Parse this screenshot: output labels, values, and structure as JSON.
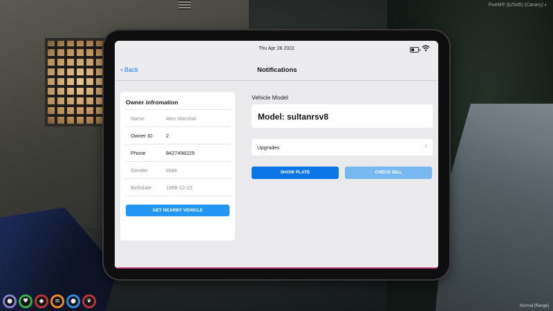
{
  "overlay": {
    "fivem_label": "FiveM® (b2545) (Canary) ◐",
    "voice_range": "Normal [Range]"
  },
  "hud": {
    "icons": [
      {
        "name": "microphone-icon",
        "glyph": "🎙",
        "color": "#8a7fd8"
      },
      {
        "name": "heart-icon",
        "glyph": "♥",
        "color": "#34b24a"
      },
      {
        "name": "shield-icon",
        "glyph": "⛉",
        "color": "#c0323a"
      },
      {
        "name": "burger-icon",
        "glyph": "≡",
        "color": "#f08a24"
      },
      {
        "name": "water-drop-icon",
        "glyph": "💧",
        "color": "#2a8ae0"
      },
      {
        "name": "brain-icon",
        "glyph": "❦",
        "color": "#c0323a"
      }
    ]
  },
  "tablet": {
    "status": {
      "date": "Thu Apr 28 2022"
    },
    "nav": {
      "back_label": "Back",
      "title": "Notifications"
    },
    "owner": {
      "title": "Owner infromation",
      "rows": [
        {
          "label": "Name",
          "value": "Alex Marshal"
        },
        {
          "label": "Owner ID",
          "value": "2"
        },
        {
          "label": "Phone",
          "value": "8427498225"
        },
        {
          "label": "Gender",
          "value": "Male"
        },
        {
          "label": "Birthdate",
          "value": "1998-12-22"
        }
      ],
      "nearby_button": "GET NEARBY VEHICLE"
    },
    "vehicle": {
      "section_label": "Vehicle Model",
      "model_text": "Model: sultanrsv8",
      "upgrades_label": "Upgrades",
      "show_plate_button": "SHOW PLATE",
      "check_bill_button": "CHECK BILL"
    },
    "colors": {
      "accent": "#0a75e6",
      "accent_light": "#78b8f0",
      "nearby": "#2196f3"
    }
  }
}
